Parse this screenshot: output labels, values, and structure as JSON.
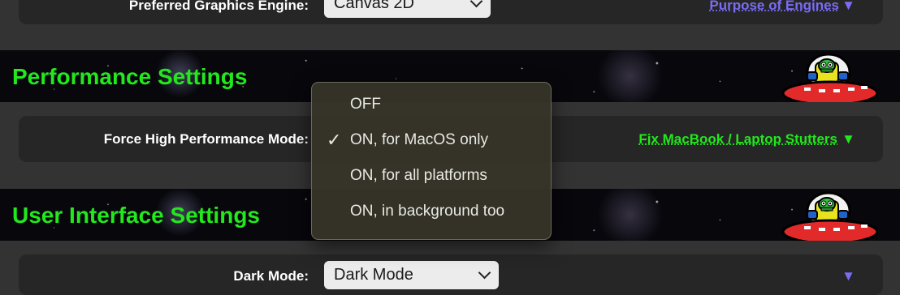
{
  "graphics_row": {
    "label": "Preferred Graphics Engine:",
    "select_value": "Canvas 2D",
    "help_link": "Purpose of Engines",
    "help_arrow": "▼"
  },
  "performance_section": {
    "title": "Performance Settings"
  },
  "performance_row": {
    "label": "Force High Performance Mode:",
    "help_link": "Fix MacBook / Laptop Stutters",
    "help_arrow": "▼"
  },
  "ui_section": {
    "title": "User Interface Settings"
  },
  "dark_mode_row": {
    "label": "Dark Mode:",
    "select_value": "Dark Mode",
    "help_arrow": "▼"
  },
  "popup": {
    "check_glyph": "✓",
    "options": [
      "OFF",
      "ON, for MacOS only",
      "ON, for all platforms",
      "ON, in background too"
    ],
    "selected_index": 1
  },
  "colors": {
    "section_title": "#22e81c",
    "graphics_link": "#7a6cf5",
    "performance_link": "#22e81c",
    "page_bg": "#333333",
    "row_bg": "#262626"
  },
  "icons": {
    "mascot": "alien-ufo-icon",
    "check": "checkmark-icon",
    "caret": "chevron-down-icon"
  }
}
